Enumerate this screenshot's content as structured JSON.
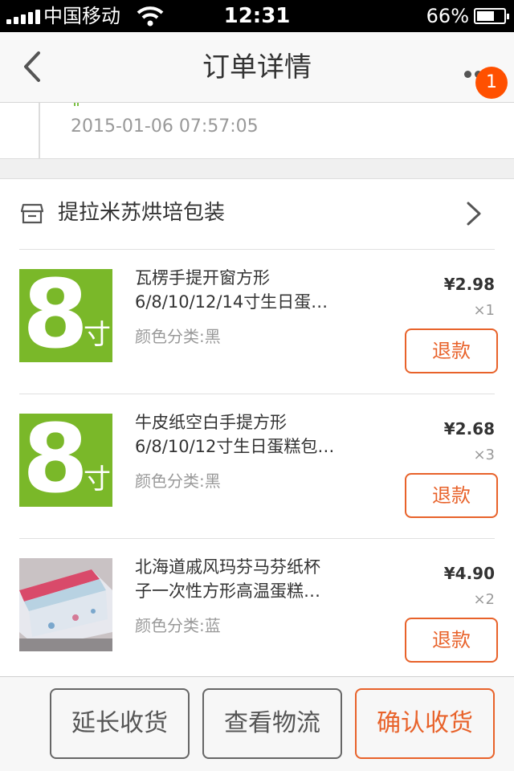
{
  "status_bar": {
    "carrier": "中国移动",
    "time": "12:31",
    "battery": "66%",
    "battery_level": 0.66,
    "signal_bars": 5
  },
  "nav": {
    "title": "订单详情",
    "badge": "1",
    "icons": {
      "back": "back-arrow-icon",
      "more": "more-dots-icon"
    }
  },
  "logistics": {
    "time": "2015-01-06 07:57:05"
  },
  "shop": {
    "name": "提拉米苏烘培包装",
    "icons": {
      "store": "store-icon",
      "chevron": "chevron-right-icon"
    }
  },
  "items": [
    {
      "title_line1": "瓦楞手提开窗方形",
      "title_line2": "6/8/10/12/14寸生日蛋…",
      "sku": "颜色分类:黑",
      "price": "¥2.98",
      "qty": "×1",
      "refund_label": "退款",
      "thumb_big": "8",
      "thumb_small": "寸"
    },
    {
      "title_line1": "牛皮纸空白手提方形",
      "title_line2": "6/8/10/12寸生日蛋糕包…",
      "sku": "颜色分类:黑",
      "price": "¥2.68",
      "qty": "×3",
      "refund_label": "退款",
      "thumb_big": "8",
      "thumb_small": "寸"
    },
    {
      "title_line1": "北海道戚风玛芬马芬纸杯",
      "title_line2": "子一次性方形高温蛋糕…",
      "sku": "颜色分类:蓝",
      "price": "¥4.90",
      "qty": "×2",
      "refund_label": "退款"
    }
  ],
  "actions": {
    "extend": "延长收货",
    "logistics": "查看物流",
    "confirm": "确认收货"
  },
  "colors": {
    "accent": "#e8622a",
    "badge": "#ff5000",
    "thumb_green": "#7ab829"
  }
}
